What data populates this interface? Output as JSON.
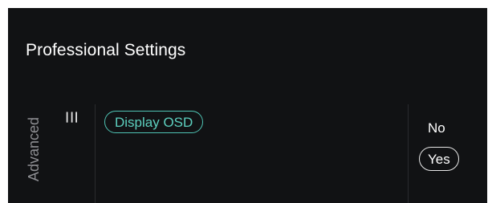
{
  "header": {
    "title": "Professional Settings"
  },
  "category": {
    "label": "Advanced",
    "icon": "menu-lines-icon",
    "icon_glyph": "☰"
  },
  "settings": [
    {
      "label": "Display OSD",
      "selected": true
    }
  ],
  "options": {
    "no_label": "No",
    "yes_label": "Yes",
    "selected": "Yes"
  },
  "colors": {
    "background": "#111214",
    "accent": "#4fc4b4",
    "text": "#ffffff",
    "muted_text": "#8d8e92"
  }
}
